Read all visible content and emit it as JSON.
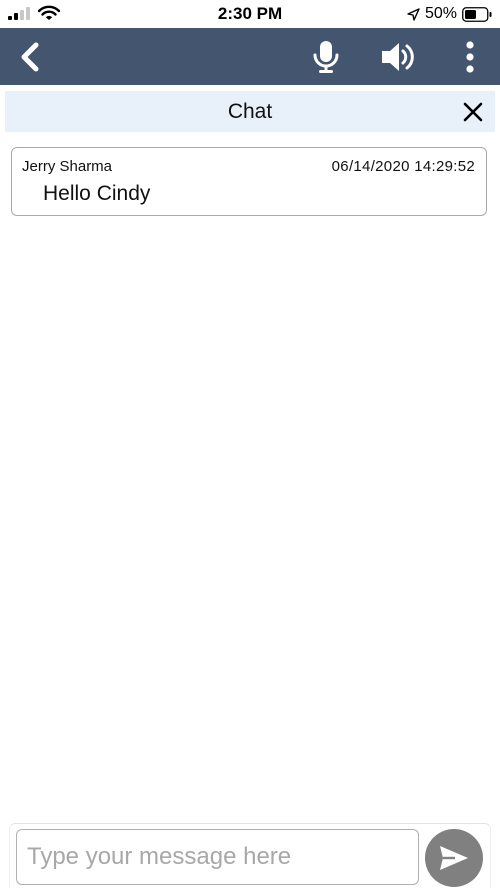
{
  "status_bar": {
    "time": "2:30 PM",
    "battery_text": "50%",
    "icons": [
      "signal-icon",
      "wifi-icon",
      "location-icon",
      "battery-icon"
    ]
  },
  "toolbar": {
    "icons": [
      "back-icon",
      "microphone-icon",
      "speaker-icon",
      "more-vertical-icon"
    ],
    "background_color": "#44566f"
  },
  "chat": {
    "title": "Chat",
    "header_background": "#e8f0fa",
    "messages": [
      {
        "sender": "Jerry Sharma",
        "timestamp": "06/14/2020 14:29:52",
        "text": "Hello Cindy"
      }
    ]
  },
  "composer": {
    "placeholder": "Type your message here",
    "value": "",
    "send_icon": "send-icon",
    "send_button_color": "#808080"
  }
}
